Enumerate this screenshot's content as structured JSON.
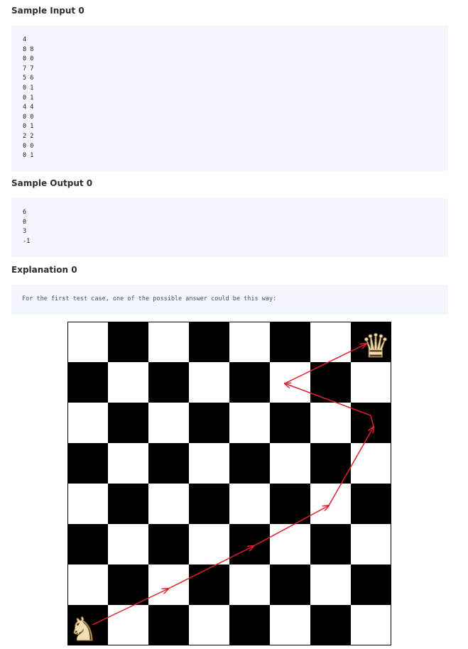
{
  "sample_input": {
    "title": "Sample Input 0",
    "lines": [
      "4",
      "8 8",
      "0 0",
      "7 7",
      "5 6",
      "0 1",
      "0 1",
      "4 4",
      "0 0",
      "0 1",
      "2 2",
      "0 0",
      "0 1"
    ]
  },
  "sample_output": {
    "title": "Sample Output 0",
    "lines": [
      "6",
      "0",
      "3",
      "-1"
    ]
  },
  "explanation": {
    "title": "Explanation 0",
    "text": "For the first test case, one of the possible answer could be this way:"
  },
  "board": {
    "size": 8,
    "dark_color": "#000000",
    "light_color": "#ffffff",
    "arrow_color": "#e0202e",
    "knight_icon": "white-knight-icon",
    "queen_icon": "white-queen-icon"
  }
}
